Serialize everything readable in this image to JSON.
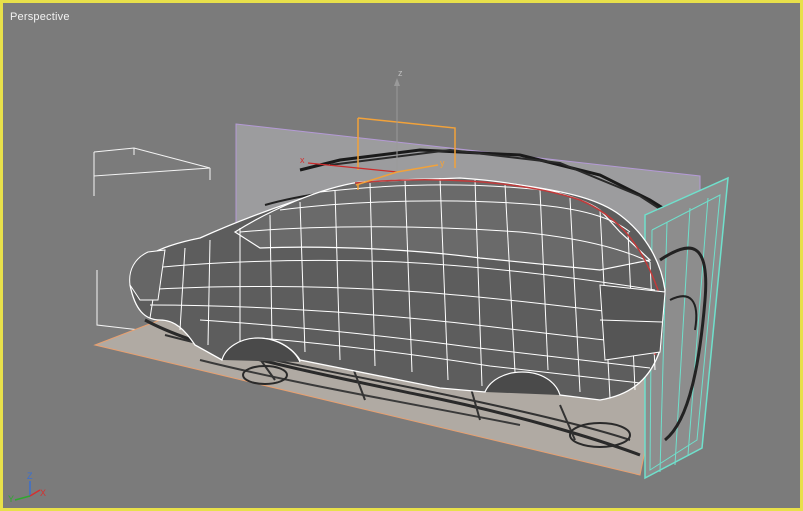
{
  "viewport": {
    "label": "Perspective",
    "border_color": "#e8e04a",
    "background_color": "#7b7b7b",
    "active": true
  },
  "gizmo": {
    "x_label": "x",
    "y_label": "y",
    "z_label": "z"
  },
  "view_cube": {
    "x_label": "X",
    "y_label": "Y",
    "z_label": "Z"
  },
  "colors": {
    "wireframe": "#ffffff",
    "mesh_fill": "#5e5e5e",
    "selection": "#f2a23a",
    "reference_plane_side": "#9a9aa6",
    "reference_plane_bottom": "#b1aaa2",
    "reference_plane_back": "#6fe0cc"
  }
}
